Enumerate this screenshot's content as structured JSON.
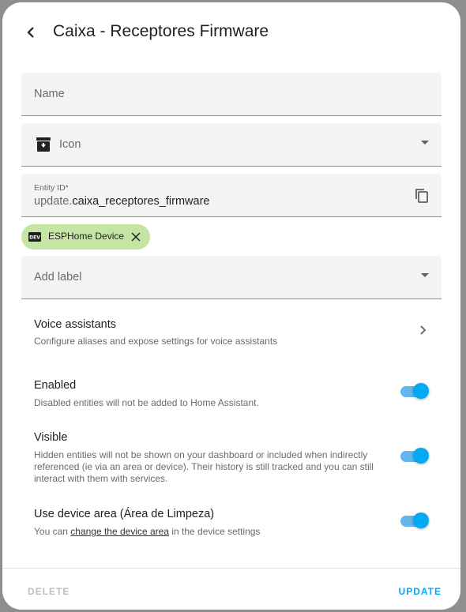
{
  "dialog": {
    "title": "Caixa - Receptores Firmware"
  },
  "fields": {
    "name_placeholder": "Name",
    "icon_placeholder": "Icon",
    "entity_id_label": "Entity ID*",
    "entity_id_prefix": "update.",
    "entity_id_value": "caixa_receptores_firmware",
    "label_placeholder": "Add label"
  },
  "chip": {
    "label": "ESPHome Device",
    "icon_text": "DEV"
  },
  "voice": {
    "title": "Voice assistants",
    "subtitle": "Configure aliases and expose settings for voice assistants"
  },
  "enabled": {
    "title": "Enabled",
    "subtitle": "Disabled entities will not be added to Home Assistant.",
    "on": true
  },
  "visible": {
    "title": "Visible",
    "subtitle": "Hidden entities will not be shown on your dashboard or included when indirectly referenced (ie via an area or device). Their history is still tracked and you can still interact with them with services.",
    "on": true
  },
  "device_area": {
    "title": "Use device area (Área de Limpeza)",
    "subtitle_before": "You can ",
    "subtitle_link": "change the device area",
    "subtitle_after": " in the device settings",
    "on": true
  },
  "footer": {
    "delete_label": "DELETE",
    "update_label": "UPDATE"
  },
  "colors": {
    "accent": "#03a9f4",
    "chip_bg": "#c5e5a5",
    "field_bg": "#f4f4f4"
  }
}
